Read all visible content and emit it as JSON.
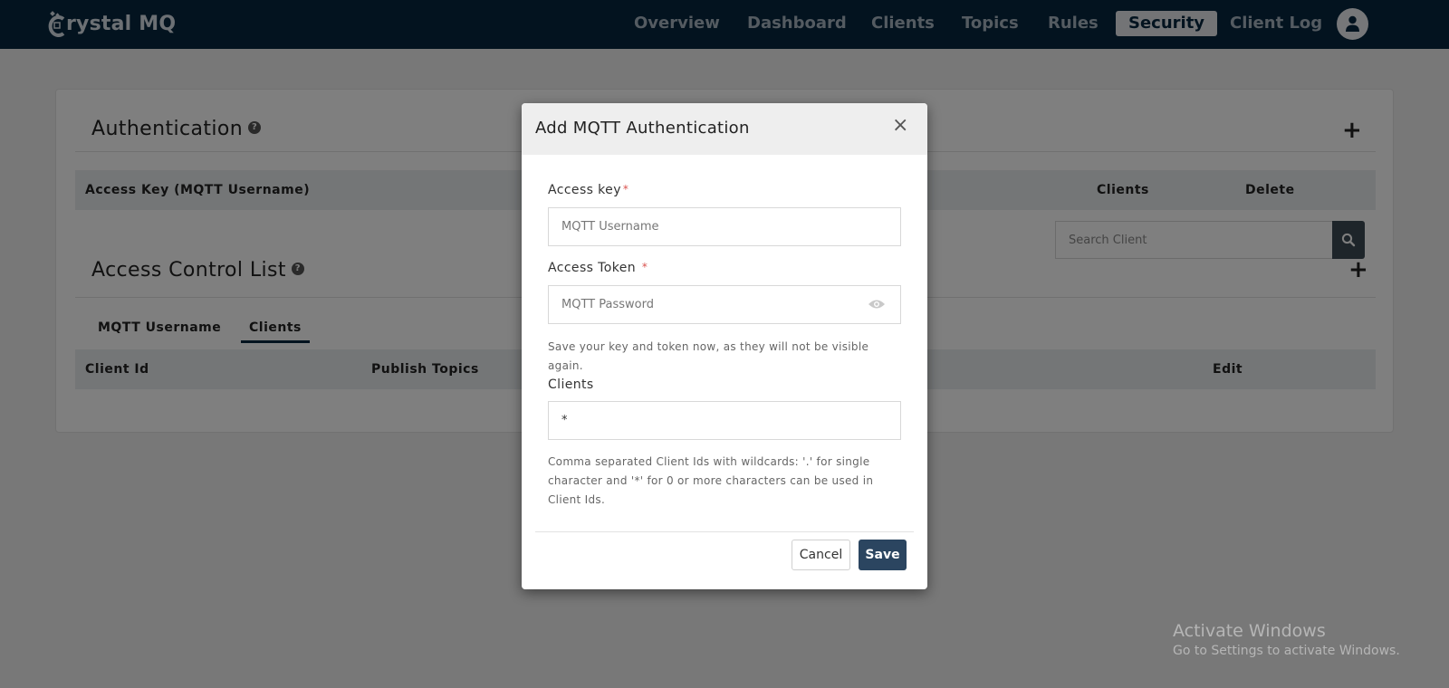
{
  "app": {
    "logo_text": "rystal MQ",
    "logo_letter": "C"
  },
  "nav": {
    "items": [
      {
        "label": "Overview"
      },
      {
        "label": "Dashboard"
      },
      {
        "label": "Clients"
      },
      {
        "label": "Topics"
      },
      {
        "label": "Rules"
      },
      {
        "label": "Security",
        "active": true
      },
      {
        "label": "Client Log"
      }
    ]
  },
  "authentication": {
    "title": "Authentication",
    "columns": [
      "Access Key (MQTT Username)",
      "Clients",
      "Delete"
    ]
  },
  "acl": {
    "title": "Access Control List",
    "tabs": [
      "MQTT Username",
      "Clients"
    ],
    "active_tab": "Clients",
    "search_placeholder": "Search Client",
    "columns": [
      "Client Id",
      "Publish Topics",
      "Edit"
    ]
  },
  "modal": {
    "title": "Add MQTT Authentication",
    "close": "×",
    "access_key_label": "Access key",
    "access_key_placeholder": "MQTT Username",
    "access_token_label": "Access Token",
    "access_token_placeholder": "MQTT Password",
    "required_mark": "*",
    "save_hint": "Save your key and token now, as they will not be visible again.",
    "clients_label": "Clients",
    "clients_value": "*",
    "clients_hint": "Comma separated Client Ids with wildcards: '.' for single character and '*' for 0 or more characters can be used in Client Ids.",
    "cancel_label": "Cancel",
    "save_label": "Save"
  },
  "watermark": {
    "line1": "Activate Windows",
    "line2": "Go to Settings to activate Windows."
  },
  "colors": {
    "navbar": "#07263f",
    "primary_button": "#2b4560",
    "required": "#d9534f"
  }
}
